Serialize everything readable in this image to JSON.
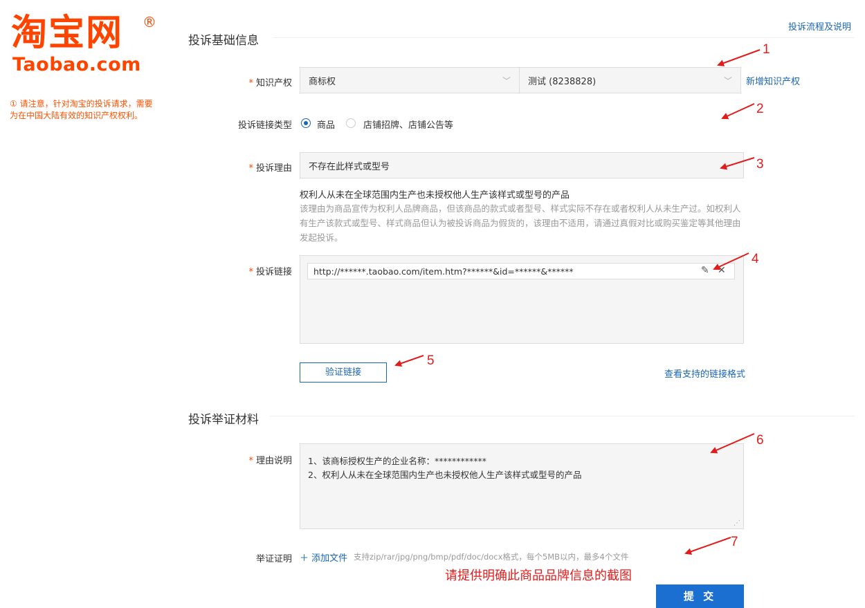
{
  "logo": {
    "cn": "淘宝网",
    "en": "Taobao.com",
    "reg": "®"
  },
  "notice": "① 请注意，针对淘宝的投诉请求，需要为在中国大陆有效的知识产权权利。",
  "top_link": "投诉流程及说明",
  "section1": {
    "title": "投诉基础信息"
  },
  "ip": {
    "label": "知识产权",
    "select1": "商标权",
    "select2": "测试 (8238828)",
    "add_link": "新增知识产权"
  },
  "link_type": {
    "label": "投诉链接类型",
    "options": [
      "商品",
      "店铺招牌、店铺公告等"
    ]
  },
  "reason": {
    "label": "投诉理由",
    "value": "不存在此样式或型号",
    "hint_title": "权利人从未在全球范围内生产也未授权他人生产该样式或型号的产品",
    "hint_body": "该理由为商品宣传为权利人品牌商品，但该商品的款式或者型号、样式实际不存在或者权利人从未生产过。如权利人有生产该款式或型号、样式商品但认为被投诉商品为假货的，该理由不适用，请通过真假对比或购买鉴定等其他理由发起投诉。"
  },
  "links": {
    "label": "投诉链接",
    "url": "http://******.taobao.com/item.htm?******&id=******&******",
    "verify_button": "验证链接",
    "formats_link": "查看支持的链接格式"
  },
  "section2": {
    "title": "投诉举证材料"
  },
  "explain": {
    "label": "理由说明",
    "line1": "1、该商标授权生产的企业名称：************",
    "line2": "2、权利人从未在全球范围内生产也未授权他人生产该样式或型号的产品"
  },
  "evidence": {
    "label": "举证证明",
    "add_icon": "plus-icon",
    "add_label": "添加文件",
    "hint": "支持zip/rar/jpg/png/bmp/pdf/doc/docx格式，每个5MB以内，最多4个文件"
  },
  "annotation_note": "请提供明确此商品品牌信息的截图",
  "submit": "提 交",
  "annotations": [
    "1",
    "2",
    "3",
    "4",
    "5",
    "6",
    "7"
  ],
  "colors": {
    "brand": "#ff4400",
    "link": "#1a66b3",
    "primary": "#1a6fd1",
    "annotation": "#e21b1b"
  }
}
